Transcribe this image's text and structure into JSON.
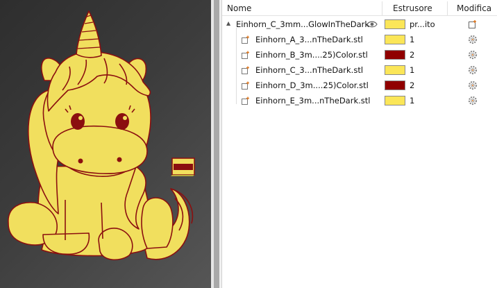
{
  "viewport": {
    "model_primary_color": "#f1df5e",
    "model_accent_color": "#8b0f0f",
    "background_color": "#3a3a3a"
  },
  "object_list": {
    "headers": {
      "name": "Nome",
      "extruder": "Estrusore",
      "modify": "Modifica"
    },
    "root": {
      "name": "Einhorn_C_3mm...GlowInTheDark",
      "extruder_label": "pr...ito",
      "swatch_color": "#fbe658",
      "icons": {
        "visibility": "eye-icon",
        "modify": "add-modifier-icon"
      }
    },
    "parts": [
      {
        "name": "Einhorn_A_3...nTheDark.stl",
        "extruder": "1",
        "swatch_color": "#fbe658",
        "modify_icon": "gear-icon"
      },
      {
        "name": "Einhorn_B_3m....25)Color.stl",
        "extruder": "2",
        "swatch_color": "#900000",
        "modify_icon": "gear-icon"
      },
      {
        "name": "Einhorn_C_3...nTheDark.stl",
        "extruder": "1",
        "swatch_color": "#fbe658",
        "modify_icon": "gear-icon"
      },
      {
        "name": "Einhorn_D_3m....25)Color.stl",
        "extruder": "2",
        "swatch_color": "#900000",
        "modify_icon": "gear-icon"
      },
      {
        "name": "Einhorn_E_3m...nTheDark.stl",
        "extruder": "1",
        "swatch_color": "#fbe658",
        "modify_icon": "gear-icon"
      }
    ]
  }
}
